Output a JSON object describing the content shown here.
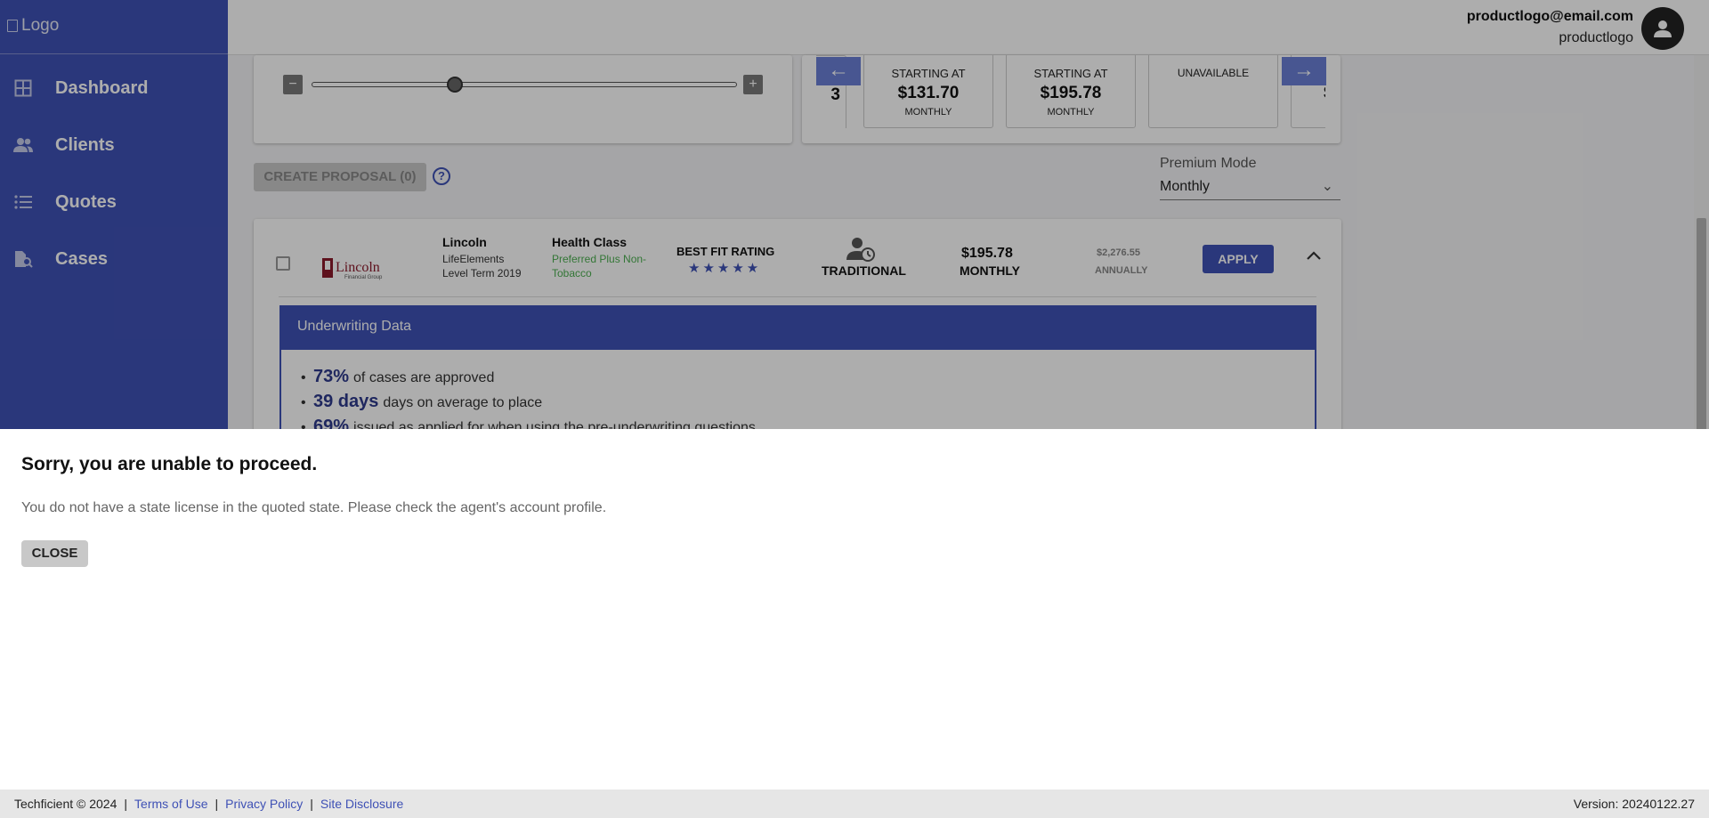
{
  "sidebar": {
    "logo_alt": "Logo",
    "items": [
      {
        "label": "Dashboard",
        "icon": "dashboard-icon"
      },
      {
        "label": "Clients",
        "icon": "clients-icon"
      },
      {
        "label": "Quotes",
        "icon": "quotes-icon"
      },
      {
        "label": "Cases",
        "icon": "cases-icon"
      }
    ]
  },
  "header": {
    "user_email": "productlogo@email.com",
    "user_name": "productlogo"
  },
  "comparison": {
    "partial_left_label": "T",
    "partial_left_value": "3",
    "cards": [
      {
        "label": "STARTING AT",
        "amount": "$131.70",
        "period": "MONTHLY"
      },
      {
        "label": "STARTING AT",
        "amount": "$195.78",
        "period": "MONTHLY"
      },
      {
        "label": "UNAVAILABLE",
        "amount": "",
        "period": ""
      }
    ],
    "partial_right_label": "S",
    "partial_right_value": "$"
  },
  "toolbar": {
    "create_proposal_label": "CREATE PROPOSAL (0)",
    "help_label": "?",
    "premium_mode_label": "Premium Mode",
    "premium_mode_value": "Monthly"
  },
  "quote": {
    "carrier_name": "Lincoln",
    "logo_text": "Lincoln",
    "logo_subtext": "Financial Group",
    "product_name": "LifeElements Level Term 2019",
    "health_class_title": "Health Class",
    "health_class_value": "Preferred Plus Non-Tobacco",
    "best_fit_title": "BEST FIT RATING",
    "stars": "★★★★★",
    "rating_stars": 5,
    "policy_type": "TRADITIONAL",
    "monthly_amount": "$195.78",
    "monthly_label": "MONTHLY",
    "annual_amount": "$2,276.55",
    "annual_label": "ANNUALLY",
    "apply_label": "APPLY"
  },
  "underwriting": {
    "title": "Underwriting Data",
    "items": [
      {
        "value": "73%",
        "text": "of cases are approved"
      },
      {
        "value": "39 days",
        "text": "days on average to place"
      },
      {
        "value": "69%",
        "text": "issued as applied for when using the pre-underwriting questions"
      }
    ]
  },
  "modal": {
    "title": "Sorry, you are unable to proceed.",
    "message": "You do not have a state license in the quoted state. Please check the agent's account profile.",
    "close_label": "CLOSE"
  },
  "footer": {
    "copyright": "Techficient © 2024",
    "separator": "|",
    "terms": "Terms of Use",
    "privacy": "Privacy Policy",
    "disclosure": "Site Disclosure",
    "version": "Version: 20240122.27"
  },
  "colors": {
    "primary": "#3f51b5",
    "success": "#4caf50",
    "overlay": "rgba(0,0,0,0.32)"
  }
}
